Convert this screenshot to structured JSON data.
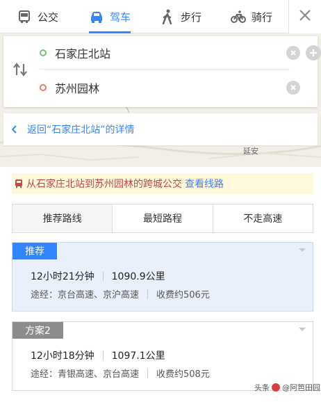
{
  "modes": [
    {
      "label": "公交",
      "icon": "bus-icon"
    },
    {
      "label": "驾车",
      "icon": "car-icon",
      "active": true
    },
    {
      "label": "步行",
      "icon": "walk-icon"
    },
    {
      "label": "骑行",
      "icon": "bike-icon"
    }
  ],
  "route": {
    "start": "石家庄北站",
    "end": "苏州园林"
  },
  "back_link": "返回“石家庄北站”的详情",
  "map_labels": [
    "延安"
  ],
  "notice": {
    "text": "从石家庄北站到苏州园林的跨城公交",
    "link": "查看线路"
  },
  "pref_tabs": [
    "推荐路线",
    "最短路程",
    "不走高速"
  ],
  "plans": [
    {
      "tag": "推荐",
      "duration": "12小时21分钟",
      "distance": "1090.9公里",
      "via": "途经：京台高速、京沪高速",
      "toll": "收费约506元"
    },
    {
      "tag": "方案2",
      "duration": "12小时18分钟",
      "distance": "1097.1公里",
      "via": "途经：青银高速、京台高速",
      "toll": "收费约508元"
    }
  ],
  "watermark": {
    "prefix": "头条",
    "name": "@阿笆田园"
  },
  "colors": {
    "accent": "#3385ff",
    "notice_bg": "#fff8dc",
    "notice_text": "#c04848"
  }
}
